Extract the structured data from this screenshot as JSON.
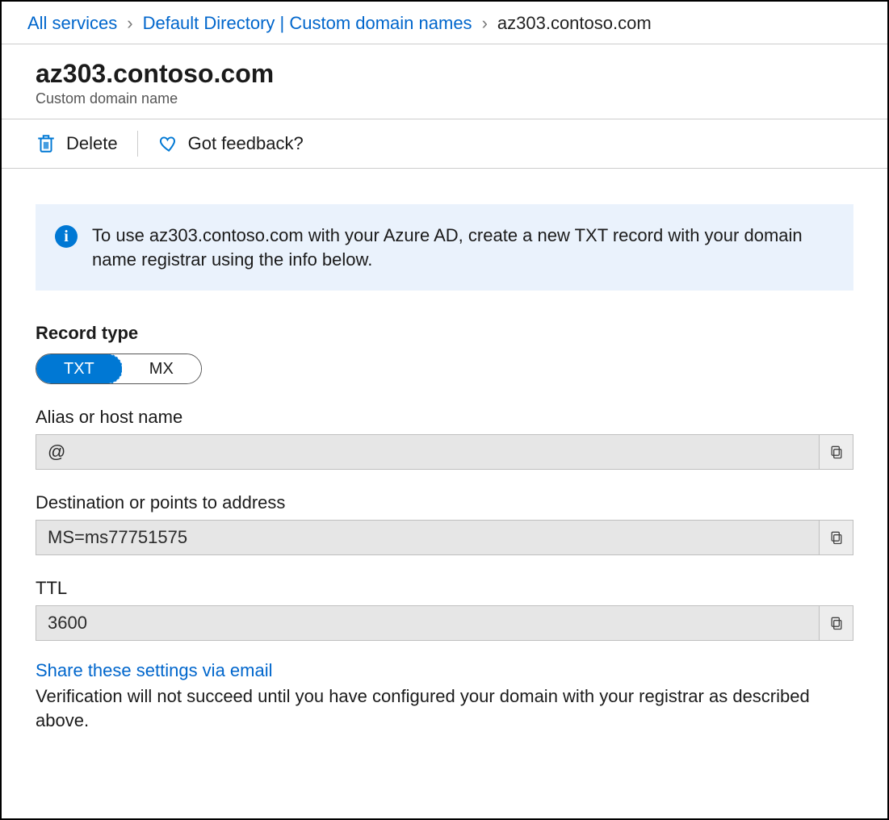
{
  "breadcrumb": {
    "items": [
      {
        "label": "All services",
        "link": true
      },
      {
        "label": "Default Directory | Custom domain names",
        "link": true
      },
      {
        "label": "az303.contoso.com",
        "link": false
      }
    ]
  },
  "header": {
    "title": "az303.contoso.com",
    "subtitle": "Custom domain name"
  },
  "toolbar": {
    "delete_label": "Delete",
    "feedback_label": "Got feedback?"
  },
  "info": {
    "text": "To use az303.contoso.com with your Azure AD, create a new TXT record with your domain name registrar using the info below."
  },
  "form": {
    "record_type_label": "Record type",
    "record_type_options": {
      "txt": "TXT",
      "mx": "MX"
    },
    "record_type_selected": "TXT",
    "alias_label": "Alias or host name",
    "alias_value": "@",
    "destination_label": "Destination or points to address",
    "destination_value": "MS=ms77751575",
    "ttl_label": "TTL",
    "ttl_value": "3600"
  },
  "footer": {
    "share_link_text": "Share these settings via email",
    "verification_note": "Verification will not succeed until you have configured your domain with your registrar as described above."
  }
}
